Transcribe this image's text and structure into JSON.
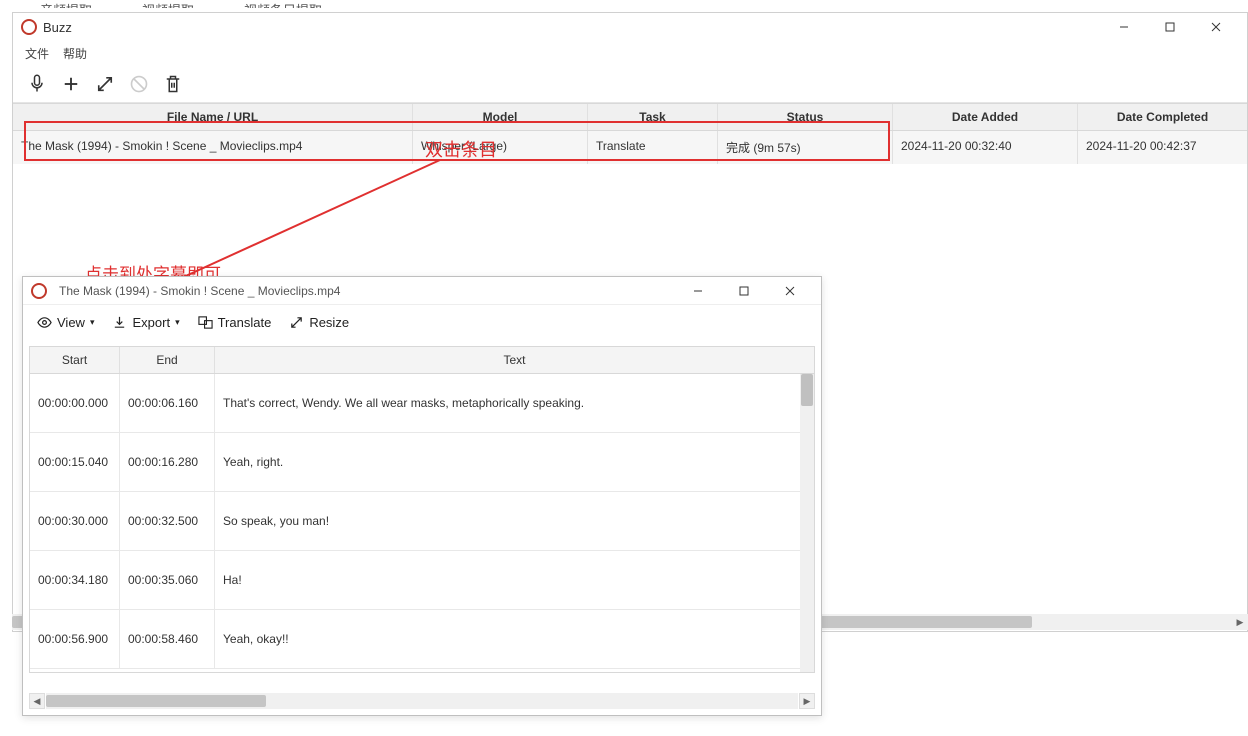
{
  "topTabs": [
    "音频提取",
    "视频提取",
    "视频条目提取"
  ],
  "mainWindow": {
    "title": "Buzz",
    "menu": {
      "file": "文件",
      "help": "帮助"
    }
  },
  "table": {
    "headers": {
      "fileName": "File Name / URL",
      "model": "Model",
      "task": "Task",
      "status": "Status",
      "dateAdded": "Date Added",
      "dateCompleted": "Date Completed"
    },
    "rows": [
      {
        "fileName": "The Mask (1994) - Smokin ! Scene _ Movieclips.mp4",
        "model": "Whisper (Large)",
        "task": "Translate",
        "status": "完成 (9m 57s)",
        "dateAdded": "2024-11-20 00:32:40",
        "dateCompleted": "2024-11-20 00:42:37"
      }
    ]
  },
  "annotations": {
    "doubleClick": "双击条目",
    "clickSubtitle": "点击到处字幕即可"
  },
  "detailWindow": {
    "title": "The Mask (1994) - Smokin ! Scene _ Movieclips.mp4",
    "toolbar": {
      "view": "View",
      "export": "Export",
      "translate": "Translate",
      "resize": "Resize"
    },
    "subTable": {
      "headers": {
        "start": "Start",
        "end": "End",
        "text": "Text"
      },
      "rows": [
        {
          "start": "00:00:00.000",
          "end": "00:00:06.160",
          "text": "That's correct, Wendy. We all wear masks, metaphorically speaking."
        },
        {
          "start": "00:00:15.040",
          "end": "00:00:16.280",
          "text": "Yeah, right."
        },
        {
          "start": "00:00:30.000",
          "end": "00:00:32.500",
          "text": "So speak, you man!"
        },
        {
          "start": "00:00:34.180",
          "end": "00:00:35.060",
          "text": "Ha!"
        },
        {
          "start": "00:00:56.900",
          "end": "00:00:58.460",
          "text": "Yeah, okay!!"
        }
      ]
    }
  }
}
